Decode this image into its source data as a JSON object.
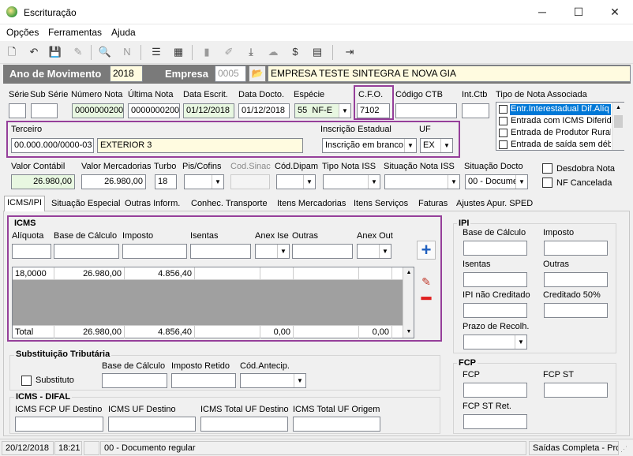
{
  "window": {
    "title": "Escrituração",
    "minimize": "─",
    "maximize": "☐",
    "close": "✕"
  },
  "menu": {
    "items": [
      "Opções",
      "Ferramentas",
      "Ajuda"
    ]
  },
  "header": {
    "ano_label": "Ano de Movimento",
    "ano_value": "2018",
    "empresa_label": "Empresa",
    "empresa_code": "0005",
    "empresa_name": "EMPRESA TESTE SINTEGRA E NOVA GIA"
  },
  "nota": {
    "serie_label": "Série",
    "subserie_label": "Sub Série",
    "numero_label": "Número Nota",
    "numero_value": "0000000200",
    "ultima_label": "Última Nota",
    "ultima_value": "0000000200",
    "data_escrit_label": "Data Escrit.",
    "data_escrit_value": "01/12/2018",
    "data_docto_label": "Data Docto.",
    "data_docto_value": "01/12/2018",
    "especie_label": "Espécie",
    "especie_code": "55",
    "especie_value": "NF-E",
    "cfo_label": "C.F.O.",
    "cfo_value": "7102",
    "codigo_ctb_label": "Código CTB",
    "intctb_label": "Int.Ctb",
    "tipo_nota_label": "Tipo de Nota Associada",
    "tipo_nota_options": [
      "Entr.Interestadual Dif.Alíq",
      "Entrada com ICMS Diferido",
      "Entrada de Produtor Rural",
      "Entrada de saída sem débi"
    ]
  },
  "terceiro": {
    "label": "Terceiro",
    "code": "00.000.000/0000-03",
    "name": "EXTERIOR 3",
    "ie_label": "Inscrição Estadual",
    "ie_value": "Inscrição em branco",
    "uf_label": "UF",
    "uf_value": "EX"
  },
  "valores": {
    "valor_contabil_label": "Valor Contábil",
    "valor_contabil": "26.980,00",
    "valor_merc_label": "Valor Mercadorias",
    "valor_merc": "26.980,00",
    "turbo_label": "Turbo",
    "turbo": "18",
    "piscofins_label": "Pis/Cofins",
    "codsinac_label": "Cod.Sinac",
    "coddipam_label": "Cód.Dipam",
    "tipo_iss_label": "Tipo Nota ISS",
    "situacao_iss_label": "Situação Nota ISS",
    "situacao_docto_label": "Situação Docto",
    "situacao_docto": "00 - Documen",
    "desdobra_label": "Desdobra Nota",
    "nf_cancelada_label": "NF Cancelada"
  },
  "tabs": [
    "ICMS/IPI",
    "Situação Especial",
    "Outras Inform.",
    "Conhec. Transporte",
    "Itens Mercadorias",
    "Itens Serviços",
    "Faturas",
    "Ajustes Apur. SPED"
  ],
  "icms": {
    "title": "ICMS",
    "aliquota_label": "Alíquota",
    "base_label": "Base de Cálculo",
    "imposto_label": "Imposto",
    "isentas_label": "Isentas",
    "anex_ise_label": "Anex Ise",
    "outras_label": "Outras",
    "anex_out_label": "Anex Out",
    "row": [
      "18,0000",
      "26.980,00",
      "4.856,40",
      "",
      "",
      "",
      "",
      ""
    ],
    "total_label": "Total",
    "total": [
      "26.980,00",
      "4.856,40",
      "",
      "0,00",
      "",
      "0,00",
      ""
    ]
  },
  "ipi": {
    "title": "IPI",
    "base_label": "Base de Cálculo",
    "imposto_label": "Imposto",
    "isentas_label": "Isentas",
    "outras_label": "Outras",
    "nao_creditado_label": "IPI não Creditado",
    "creditado_label": "Creditado 50%",
    "prazo_label": "Prazo de Recolh."
  },
  "st": {
    "title": "Substituição Tributária",
    "substituto_label": "Substituto",
    "base_label": "Base de Cálculo",
    "imposto_label": "Imposto Retido",
    "cod_label": "Cód.Antecip."
  },
  "difal": {
    "title": "ICMS - DIFAL",
    "fcp_label": "ICMS FCP UF Destino",
    "uf_dest_label": "ICMS UF Destino",
    "total_dest_label": "ICMS Total UF Destino",
    "total_orig_label": "ICMS Total UF Origem"
  },
  "fcp": {
    "title": "FCP",
    "fcp_label": "FCP",
    "fcp_st_label": "FCP ST",
    "fcp_st_ret_label": "FCP ST Ret."
  },
  "status": {
    "date": "20/12/2018",
    "time": "18:21",
    "situacao": "00 - Documento regular",
    "modo": "Saídas Completa - Pros"
  },
  "colors": {
    "highlight": "#953f9a",
    "header_bg": "#7a7a7a",
    "field_green": "#e8f7e1",
    "field_yellow": "#fffbe0"
  }
}
